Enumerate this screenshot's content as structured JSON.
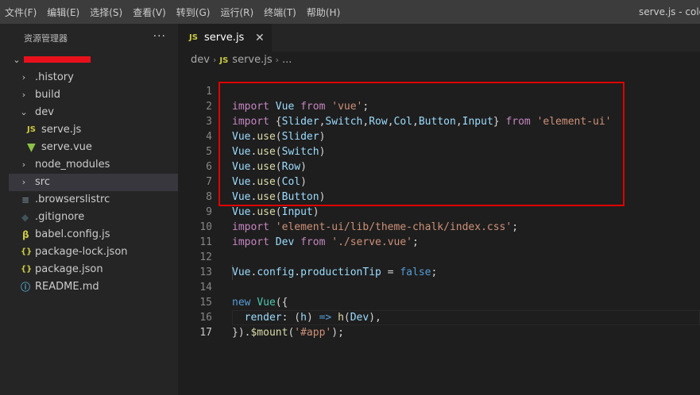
{
  "menu": [
    "文件(F)",
    "编辑(E)",
    "选择(S)",
    "查看(V)",
    "转到(G)",
    "运行(R)",
    "终端(T)",
    "帮助(H)"
  ],
  "window_title": "serve.js - colo",
  "sidebar": {
    "title": "资源管理器",
    "more": "···",
    "items": [
      {
        "label": ".history",
        "kind": "folder"
      },
      {
        "label": "build",
        "kind": "folder"
      },
      {
        "label": "dev",
        "kind": "folder-open"
      },
      {
        "label": "serve.js",
        "kind": "js"
      },
      {
        "label": "serve.vue",
        "kind": "vue"
      },
      {
        "label": "node_modules",
        "kind": "folder"
      },
      {
        "label": "src",
        "kind": "folder"
      },
      {
        "label": ".browserslistrc",
        "kind": "config"
      },
      {
        "label": ".gitignore",
        "kind": "git"
      },
      {
        "label": "babel.config.js",
        "kind": "babel"
      },
      {
        "label": "package-lock.json",
        "kind": "json"
      },
      {
        "label": "package.json",
        "kind": "json"
      },
      {
        "label": "README.md",
        "kind": "info"
      }
    ]
  },
  "tab": {
    "icon": "JS",
    "label": "serve.js",
    "close": "✕"
  },
  "breadcrumb": {
    "folder": "dev",
    "icon": "JS",
    "file": "serve.js",
    "more": "..."
  },
  "code": {
    "line_numbers": [
      "1",
      "2",
      "3",
      "4",
      "5",
      "6",
      "7",
      "8",
      "9",
      "10",
      "11",
      "12",
      "13",
      "14",
      "15",
      "16",
      "17"
    ],
    "l1": {
      "a": "import",
      "b": " ",
      "c": "Vue",
      "d": " ",
      "e": "from",
      "f": " ",
      "g": "'vue'",
      "h": ";"
    },
    "l2": {
      "a": "import",
      "b": " {",
      "c": "Slider",
      "d": ",",
      "e": "Switch",
      "f": ",",
      "g": "Row",
      "h": ",",
      "i": "Col",
      "j": ",",
      "k": "Button",
      "l": ",",
      "m": "Input",
      "n": "} ",
      "o": "from",
      "p": " ",
      "q": "'element-ui'"
    },
    "use": {
      "obj": "Vue",
      "dot": ".",
      "fn": "use",
      "open": "(",
      "close": ")"
    },
    "l3": "Slider",
    "l4": "Switch",
    "l5": "Row",
    "l6": "Col",
    "l7": "Button",
    "l8": "Input",
    "l9": {
      "a": "import",
      "b": " ",
      "c": "'element-ui/lib/theme-chalk/index.css'",
      "d": ";"
    },
    "l10": {
      "a": "import",
      "b": " ",
      "c": "Dev",
      "d": " ",
      "e": "from",
      "f": " ",
      "g": "'./serve.vue'",
      "h": ";"
    },
    "l12": {
      "a": "Vue",
      "b": ".",
      "c": "config",
      "d": ".",
      "e": "productionTip",
      "f": " = ",
      "g": "false",
      "h": ";"
    },
    "l14": {
      "a": "new",
      "b": " ",
      "c": "Vue",
      "d": "({"
    },
    "l15": {
      "a": "  ",
      "b": "render",
      "c": ": (",
      "d": "h",
      "e": ") ",
      "f": "=>",
      "g": " ",
      "h": "h",
      "i": "(",
      "j": "Dev",
      "k": "),"
    },
    "l16": {
      "a": "})",
      "b": ".",
      "c": "$mount",
      "d": "(",
      "e": "'#app'",
      "f": ");"
    }
  }
}
